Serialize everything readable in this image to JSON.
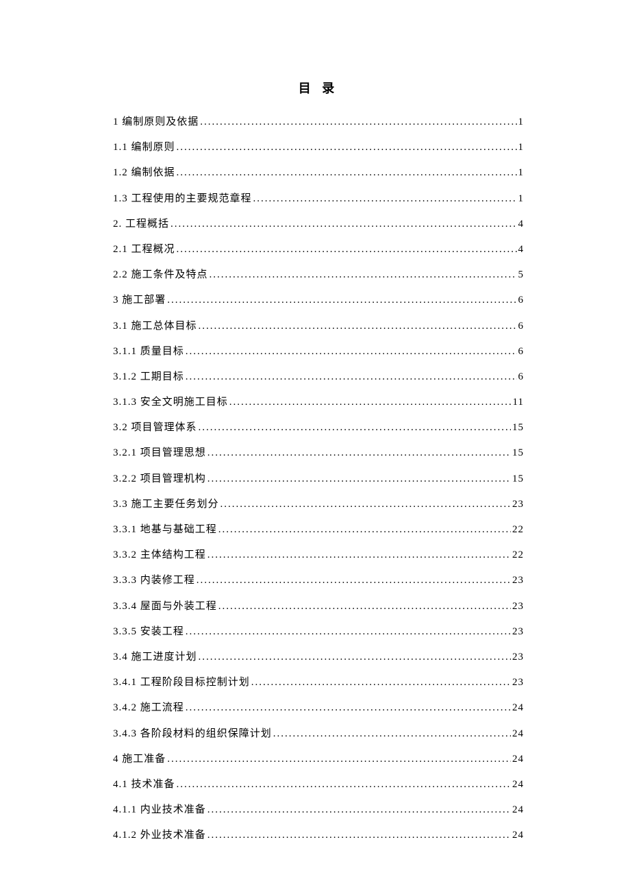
{
  "title": "目 录",
  "toc": [
    {
      "num": "1",
      "label": "编制原则及依据",
      "page": "1"
    },
    {
      "num": "1.1",
      "label": "编制原则",
      "page": "1"
    },
    {
      "num": "1.2",
      "label": "编制依据",
      "page": "1"
    },
    {
      "num": "1.3",
      "label": "工程使用的主要规范章程",
      "page": "1"
    },
    {
      "num": "2.",
      "label": "工程概括",
      "page": "4"
    },
    {
      "num": "2.1",
      "label": "工程概况",
      "page": "4"
    },
    {
      "num": "2.2",
      "label": "施工条件及特点",
      "page": "5"
    },
    {
      "num": "3",
      "label": "施工部署",
      "page": "6"
    },
    {
      "num": "3.1",
      "label": "施工总体目标",
      "page": "6"
    },
    {
      "num": "3.1.1",
      "label": "质量目标",
      "page": "6"
    },
    {
      "num": "3.1.2",
      "label": "工期目标",
      "page": "6"
    },
    {
      "num": "3.1.3",
      "label": "安全文明施工目标",
      "page": "11"
    },
    {
      "num": "3.2",
      "label": "项目管理体系",
      "page": "15"
    },
    {
      "num": "3.2.1",
      "label": "项目管理思想",
      "page": "15"
    },
    {
      "num": "3.2.2",
      "label": "项目管理机构",
      "page": "15"
    },
    {
      "num": "3.3",
      "label": "施工主要任务划分",
      "page": "23"
    },
    {
      "num": "3.3.1",
      "label": "地基与基础工程",
      "page": "22"
    },
    {
      "num": "3.3.2",
      "label": "主体结构工程",
      "page": "22"
    },
    {
      "num": "3.3.3",
      "label": "内装修工程",
      "page": "23"
    },
    {
      "num": "3.3.4",
      "label": "屋面与外装工程",
      "page": "23"
    },
    {
      "num": "3.3.5",
      "label": "安装工程",
      "page": "23"
    },
    {
      "num": "3.4",
      "label": "施工进度计划",
      "page": "23"
    },
    {
      "num": "3.4.1",
      "label": "工程阶段目标控制计划",
      "page": "23"
    },
    {
      "num": "3.4.2",
      "label": "施工流程",
      "page": "24"
    },
    {
      "num": "3.4.3",
      "label": "各阶段材料的组织保障计划",
      "page": "24"
    },
    {
      "num": "4",
      "label": "施工准备",
      "page": "24"
    },
    {
      "num": "4.1",
      "label": "技术准备",
      "page": "24"
    },
    {
      "num": "4.1.1",
      "label": "内业技术准备",
      "page": "24"
    },
    {
      "num": "4.1.2",
      "label": "外业技术准备",
      "page": "24"
    }
  ]
}
